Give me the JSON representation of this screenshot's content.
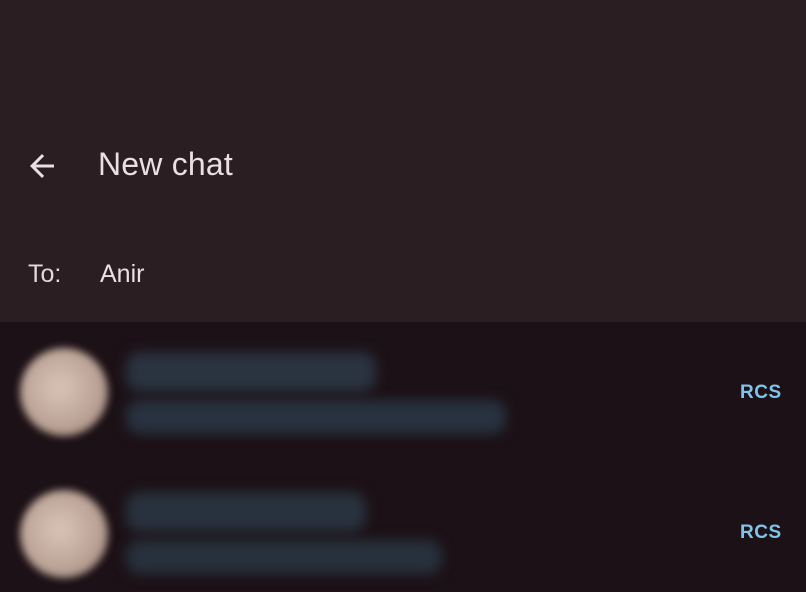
{
  "header": {
    "back_icon": "arrow-left-icon",
    "title": "New chat"
  },
  "recipient": {
    "label": "To:",
    "value": "Anir"
  },
  "contacts": [
    {
      "badge": "RCS"
    },
    {
      "badge": "RCS"
    }
  ],
  "colors": {
    "header_background": "#2b1e23",
    "list_background": "#1c1116",
    "text_primary": "#eadfe3",
    "badge_accent": "#7fc4ea"
  }
}
